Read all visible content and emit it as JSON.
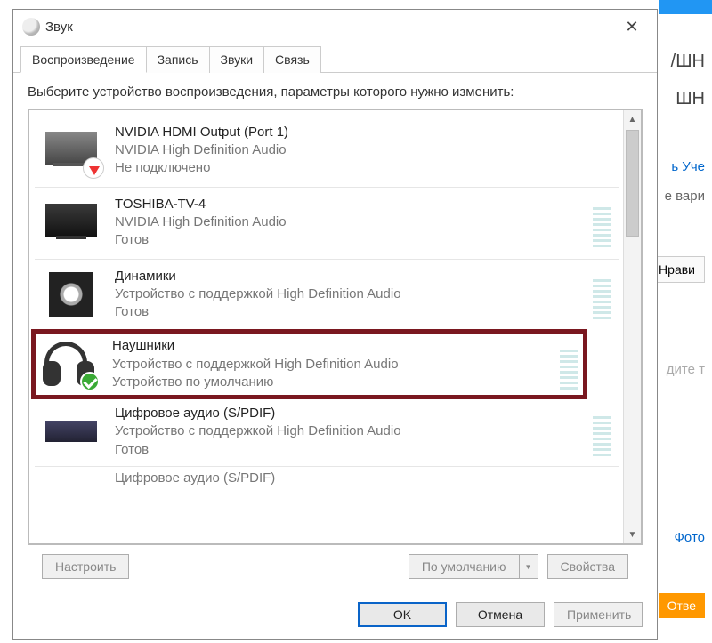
{
  "dialog": {
    "title": "Звук",
    "tabs": [
      "Воспроизведение",
      "Запись",
      "Звуки",
      "Связь"
    ],
    "active_tab_index": 0,
    "instructions": "Выберите устройство воспроизведения, параметры которого нужно изменить:",
    "devices": [
      {
        "name": "NVIDIA HDMI Output (Port 1)",
        "desc": "NVIDIA High Definition Audio",
        "status": "Не подключено",
        "icon": "monitor-unplugged",
        "default": false,
        "highlighted": false,
        "has_meter": false
      },
      {
        "name": "TOSHIBA-TV-4",
        "desc": "NVIDIA High Definition Audio",
        "status": "Готов",
        "icon": "monitor-dark",
        "default": false,
        "highlighted": false,
        "has_meter": true
      },
      {
        "name": "Динамики",
        "desc": "Устройство с поддержкой High Definition Audio",
        "status": "Готов",
        "icon": "speaker",
        "default": false,
        "highlighted": false,
        "has_meter": true
      },
      {
        "name": "Наушники",
        "desc": "Устройство с поддержкой High Definition Audio",
        "status": "Устройство по умолчанию",
        "icon": "headphones",
        "default": true,
        "highlighted": true,
        "has_meter": true
      },
      {
        "name": "Цифровое аудио (S/PDIF)",
        "desc": "Устройство с поддержкой High Definition Audio",
        "status": "Готов",
        "icon": "spdif",
        "default": false,
        "highlighted": false,
        "has_meter": true
      }
    ],
    "partial_device_name": "Цифровое аудио (S/PDIF)",
    "configure_label": "Настроить",
    "default_label": "По умолчанию",
    "properties_label": "Свойства",
    "ok_label": "OK",
    "cancel_label": "Отмена",
    "apply_label": "Применить"
  },
  "background": {
    "frag1": "/ШН",
    "frag2": "ШН",
    "frag3": "ь Уче",
    "frag4": "е вари",
    "like": "Нрави",
    "prompt": "дите т",
    "photo": "Фото",
    "answer": "Отве"
  }
}
